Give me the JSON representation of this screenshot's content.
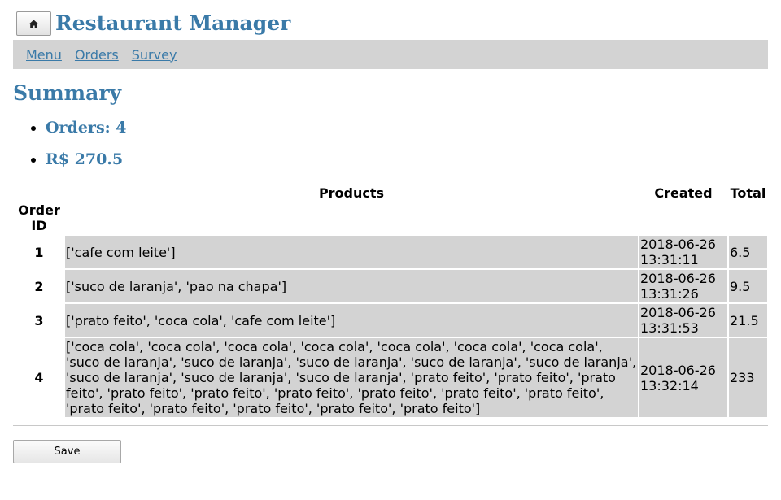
{
  "header": {
    "home_icon": "home-icon",
    "title": "Restaurant Manager"
  },
  "nav": {
    "items": [
      "Menu",
      "Orders",
      "Survey"
    ]
  },
  "summary": {
    "title": "Summary",
    "orders_count": "Orders: 4",
    "total": "R$ 270.5"
  },
  "table": {
    "headers": {
      "id": "Order ID",
      "products": "Products",
      "created": "Created",
      "total": "Total"
    },
    "rows": [
      {
        "id": "1",
        "products": "['cafe com leite']",
        "created": "2018-06-26 13:31:11",
        "total": "6.5"
      },
      {
        "id": "2",
        "products": "['suco de laranja', 'pao na chapa']",
        "created": "2018-06-26 13:31:26",
        "total": "9.5"
      },
      {
        "id": "3",
        "products": "['prato feito', 'coca cola', 'cafe com leite']",
        "created": "2018-06-26 13:31:53",
        "total": "21.5"
      },
      {
        "id": "4",
        "products": "['coca cola', 'coca cola', 'coca cola', 'coca cola', 'coca cola', 'coca cola', 'coca cola', 'suco de laranja', 'suco de laranja', 'suco de laranja', 'suco de laranja', 'suco de laranja', 'suco de laranja', 'suco de laranja', 'suco de laranja', 'prato feito', 'prato feito', 'prato feito', 'prato feito', 'prato feito', 'prato feito', 'prato feito', 'prato feito', 'prato feito', 'prato feito', 'prato feito', 'prato feito', 'prato feito', 'prato feito']",
        "created": "2018-06-26 13:32:14",
        "total": "233"
      }
    ]
  },
  "footer": {
    "save_label": "Save"
  }
}
